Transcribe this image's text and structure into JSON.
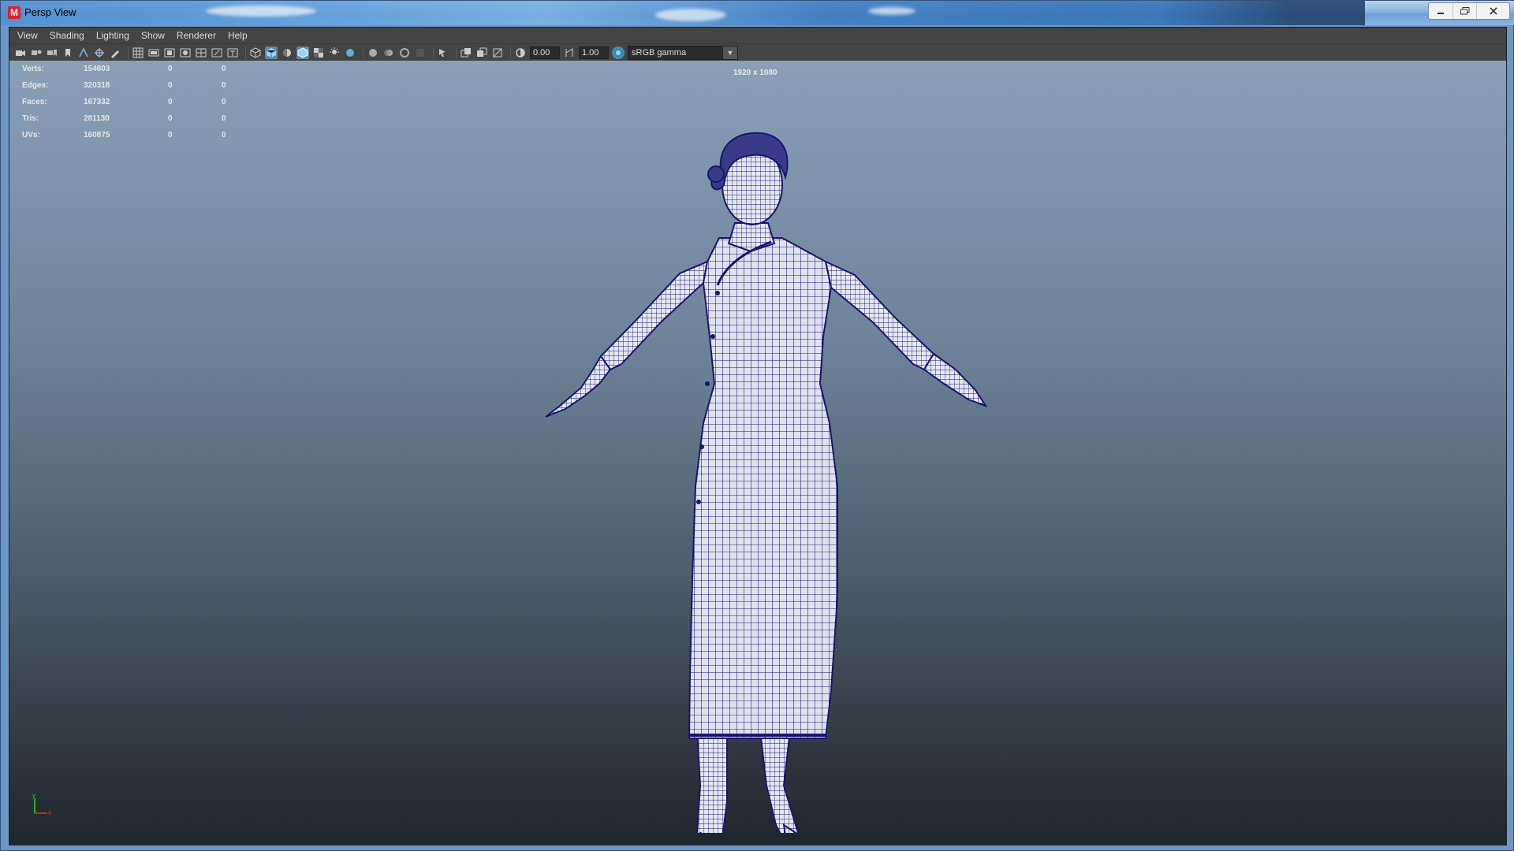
{
  "window": {
    "title": "Persp View",
    "app_icon": "M"
  },
  "menu": {
    "items": [
      "View",
      "Shading",
      "Lighting",
      "Show",
      "Renderer",
      "Help"
    ]
  },
  "toolbar": {
    "exposure_value": "0.00",
    "gamma_value": "1.00",
    "color_space": "sRGB gamma"
  },
  "hud": {
    "rows": [
      {
        "label": "Verts:",
        "value": "154603",
        "c1": "0",
        "c2": "0"
      },
      {
        "label": "Edges:",
        "value": "320318",
        "c1": "0",
        "c2": "0"
      },
      {
        "label": "Faces:",
        "value": "167332",
        "c1": "0",
        "c2": "0"
      },
      {
        "label": "Tris:",
        "value": "281130",
        "c1": "0",
        "c2": "0"
      },
      {
        "label": "UVs:",
        "value": "160875",
        "c1": "0",
        "c2": "0"
      }
    ],
    "resolution": "1920 x 1080"
  },
  "axis": {
    "y_label": "y",
    "x_label": "x"
  },
  "colors": {
    "wire": "#17166b",
    "mesh_fill": "#dfe3ef",
    "accent": "#5c88a8"
  }
}
